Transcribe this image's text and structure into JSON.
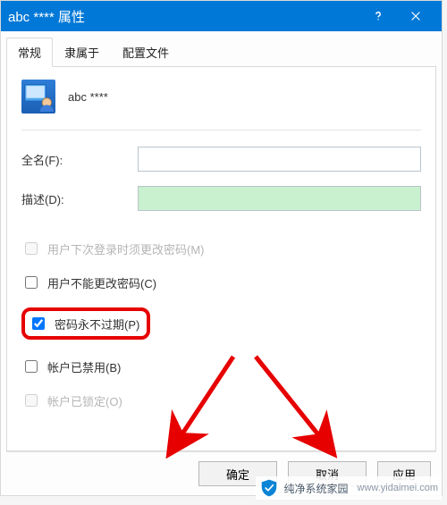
{
  "window_title": "abc **** 属性",
  "tabs": {
    "general": "常规",
    "memberof": "隶属于",
    "profile": "配置文件"
  },
  "header_name": "abc ****",
  "fields": {
    "fullname_label": "全名(F):",
    "description_label": "描述(D):"
  },
  "checks": {
    "mustchange": "用户下次登录时须更改密码(M)",
    "cannotchange": "用户不能更改密码(C)",
    "neverexpire": "密码永不过期(P)",
    "disabled": "帐户已禁用(B)",
    "locked": "帐户已锁定(O)"
  },
  "buttons": {
    "ok": "确定",
    "cancel": "取消",
    "apply": "应用"
  },
  "watermark": {
    "text": "纯净系统家园",
    "url": "www.yidaimei.com"
  }
}
